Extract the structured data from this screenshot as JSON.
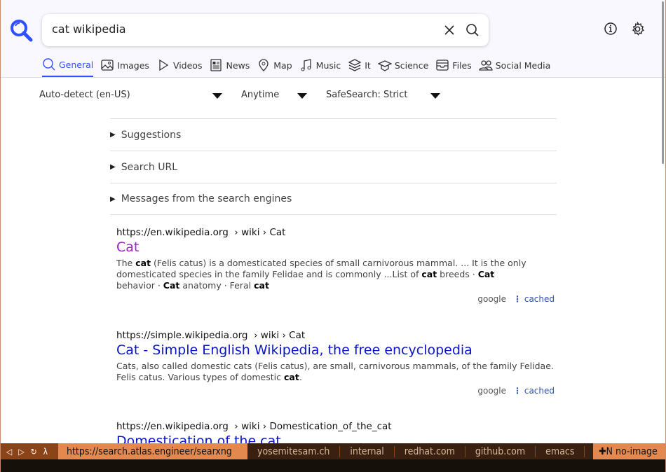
{
  "search": {
    "query": "cat wikipedia"
  },
  "tabs": [
    {
      "label": "General",
      "icon": "search-icon"
    },
    {
      "label": "Images",
      "icon": "image-icon"
    },
    {
      "label": "Videos",
      "icon": "play-icon"
    },
    {
      "label": "News",
      "icon": "newspaper-icon"
    },
    {
      "label": "Map",
      "icon": "map-pin-icon"
    },
    {
      "label": "Music",
      "icon": "music-icon"
    },
    {
      "label": "It",
      "icon": "layers-icon"
    },
    {
      "label": "Science",
      "icon": "graduation-cap-icon"
    },
    {
      "label": "Files",
      "icon": "archive-icon"
    },
    {
      "label": "Social Media",
      "icon": "people-icon"
    }
  ],
  "filters": {
    "language": "Auto-detect (en-US)",
    "time": "Anytime",
    "safesearch": "SafeSearch: Strict"
  },
  "details": [
    "Suggestions",
    "Search URL",
    "Messages from the search engines"
  ],
  "results": [
    {
      "url": "https://en.wikipedia.org",
      "path": "› wiki › Cat",
      "title": "Cat",
      "visited": true,
      "engine": "google",
      "cached": "cached"
    },
    {
      "url": "https://simple.wikipedia.org",
      "path": "› wiki › Cat",
      "title": "Cat - Simple English Wikipedia, the free encyclopedia",
      "visited": false,
      "snippet": "Cats, also called domestic cats (Felis catus), are small, carnivorous mammals, of the family Felidae. Felis catus. Various types of domestic",
      "engine": "google",
      "cached": "cached"
    },
    {
      "url": "https://en.wikipedia.org",
      "path": "› wiki › Domestication_of_the_cat",
      "title": "Domestication of the cat"
    }
  ],
  "snippet1": [
    "The ",
    "cat",
    " (Felis catus) is a domesticated species of small carnivorous mammal. ... It is the only domesticated species in the family Felidae and is commonly ...List of ",
    "cat",
    " breeds · ",
    "Cat",
    " behavior · ",
    "Cat",
    " anatomy · Feral ",
    "cat"
  ],
  "snippet2_bold": "cat",
  "statusbar": {
    "nav": [
      "◁",
      "▷",
      "↻",
      "λ"
    ],
    "url": "https://search.atlas.engineer/searxng",
    "bookmarks": [
      "yosemitesam.ch",
      "internal",
      "redhat.com",
      "github.com",
      "emacs"
    ],
    "mode": "✚N no-image"
  },
  "colors": {
    "accent": "#3050ff",
    "visited": "#9b22c8",
    "link": "#0a14c8",
    "status": "#e3894f"
  }
}
